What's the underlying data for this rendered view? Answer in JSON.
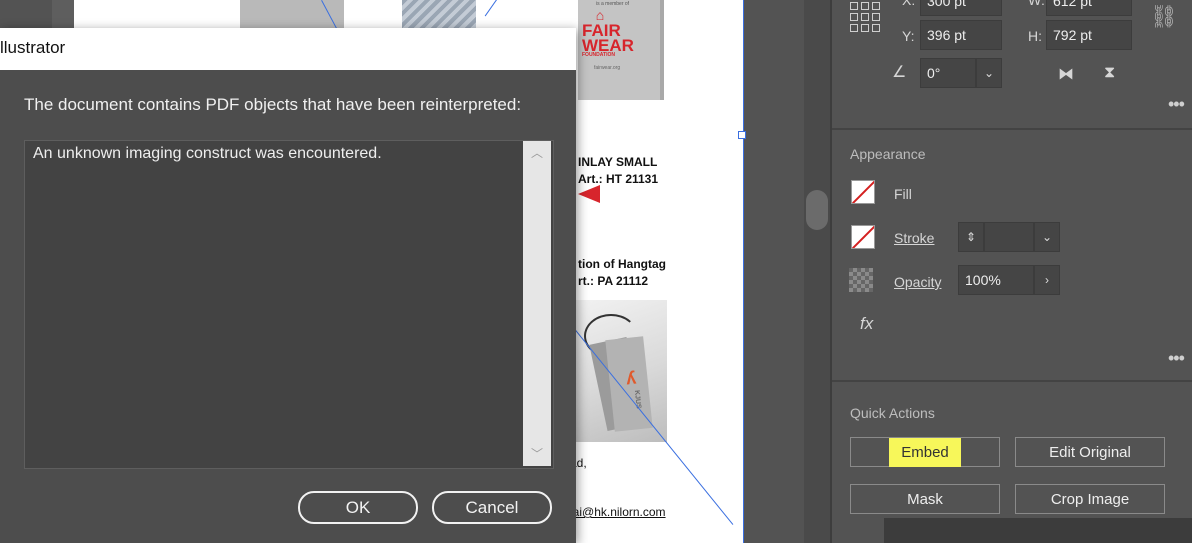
{
  "dialog": {
    "title": "llustrator",
    "message": "The document contains PDF objects that have been reinterpreted:",
    "details": "An unknown imaging construct was encountered.",
    "ok_label": "OK",
    "cancel_label": "Cancel"
  },
  "document": {
    "fairwear_member": "is a member of",
    "fairwear_logo_line1": "FAIR",
    "fairwear_logo_line2": "WEAR",
    "fairwear_sub": "FOUNDATION",
    "fairwear_url": "fairwear.org",
    "item1_line1": "INLAY SMALL",
    "item1_line2": "Art.:  HT 21131",
    "item2_line1": "tion of Hangtag",
    "item2_line2": "rt.: PA 21112",
    "tag_brand": "KJUS",
    "partial_text": "ad,",
    "email": "lai@hk.nilorn.com"
  },
  "transform": {
    "x_label": "X:",
    "x_value": "300 pt",
    "w_label": "W:",
    "w_value": "612 pt",
    "y_label": "Y:",
    "y_value": "396 pt",
    "h_label": "H:",
    "h_value": "792 pt",
    "angle_value": "0°"
  },
  "appearance": {
    "title": "Appearance",
    "fill_label": "Fill",
    "stroke_label": "Stroke",
    "opacity_label": "Opacity",
    "opacity_value": "100%",
    "fx_label": "fx"
  },
  "quick_actions": {
    "title": "Quick Actions",
    "embed_label": "Embed",
    "edit_original_label": "Edit Original",
    "mask_label": "Mask",
    "crop_image_label": "Crop Image"
  },
  "colors": {
    "highlight": "#f7f75a",
    "guide": "#3a6fe0",
    "brand_red": "#d7252c"
  }
}
